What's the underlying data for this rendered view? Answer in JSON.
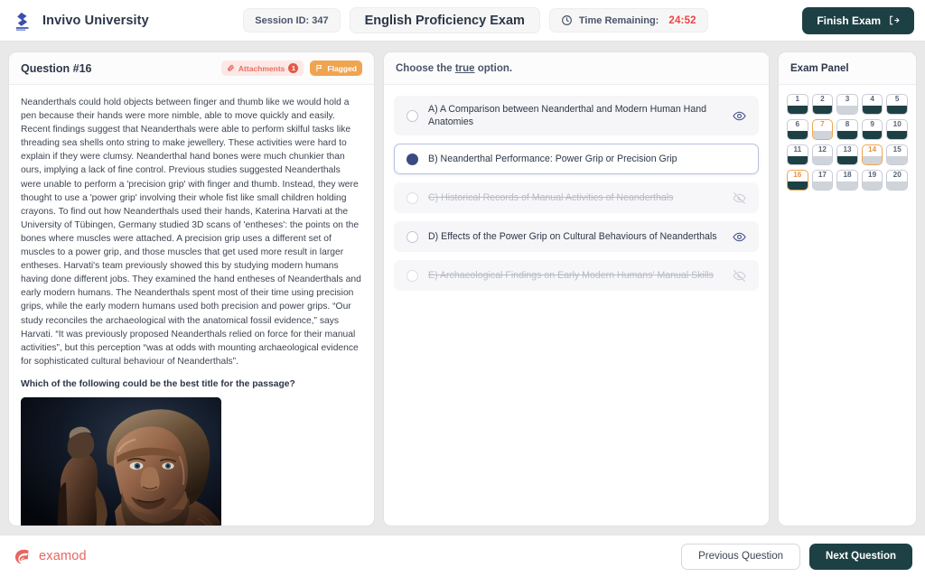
{
  "header": {
    "brand_name": "Invivo University",
    "session_pill": "Session ID: 347",
    "exam_title": "English Proficiency Exam",
    "timer_label": "Time Remaining:",
    "timer_value": "24:52",
    "finish_button": "Finish Exam"
  },
  "question_panel": {
    "title": "Question #16",
    "attachments_badge": "Attachments",
    "attachments_count": "1",
    "flagged_badge": "Flagged",
    "passage": "Neanderthals could hold objects between finger and thumb like we would hold a pen because their hands were more nimble, able to move quickly and easily. Recent findings suggest that Neanderthals were able to perform skilful tasks like threading sea shells onto string to make jewellery. These activities were hard to explain if they were clumsy. Neanderthal hand bones were much chunkier than ours, implying a lack of fine control. Previous studies suggested Neanderthals were unable to perform a 'precision grip' with finger and thumb. Instead, they were thought to use a 'power grip' involving their whole fist like small children holding crayons. To find out how Neanderthals used their hands, Katerina Harvati at the University of Tübingen, Germany studied 3D scans of 'entheses': the points on the bones where muscles were attached. A precision grip uses a different set of muscles to a power grip, and those muscles that get used more result in larger entheses. Harvati's team previously showed this by studying modern humans having done different jobs. They examined the hand entheses of Neanderthals and early modern humans. The Neanderthals spent most of their time using precision grips, while the early modern humans used both precision and power grips. “Our study reconciles the archaeological with the anatomical fossil evidence,” says Harvati. “It was previously proposed Neanderthals relied on force for their manual activities”, but this perception “was at odds with mounting archaeological evidence for sophisticated cultural behaviour of Neanderthals”.",
    "prompt": "Which of the following could be the best title for the passage?",
    "figure_alt": "Neanderthal reconstruction portrait"
  },
  "options_panel": {
    "instruction_prefix": "Choose the ",
    "instruction_emphasis": "true",
    "instruction_suffix": " option.",
    "options": [
      {
        "letter": "A",
        "text": "A) A Comparison between Neanderthal and Modern Human Hand Anatomies",
        "state": "normal",
        "eye": "eye-icon"
      },
      {
        "letter": "B",
        "text": "B) Neanderthal Performance: Power Grip or Precision Grip",
        "state": "selected",
        "eye": "none"
      },
      {
        "letter": "C",
        "text": "C) Historical Records of Manual Activities of Neanderthals",
        "state": "eliminated",
        "eye": "eye-off-icon"
      },
      {
        "letter": "D",
        "text": "D) Effects of the Power Grip on Cultural Behaviours of Neanderthals",
        "state": "normal",
        "eye": "eye-icon"
      },
      {
        "letter": "E",
        "text": "E) Archaeological Findings on Early Modern Humans' Manual Skills",
        "state": "eliminated",
        "eye": "eye-off-icon"
      }
    ]
  },
  "exam_panel": {
    "title": "Exam Panel",
    "questions": [
      {
        "number": "1",
        "answered": true,
        "flagged": false,
        "current": false
      },
      {
        "number": "2",
        "answered": true,
        "flagged": false,
        "current": false
      },
      {
        "number": "3",
        "answered": false,
        "flagged": false,
        "current": false
      },
      {
        "number": "4",
        "answered": true,
        "flagged": false,
        "current": false
      },
      {
        "number": "5",
        "answered": true,
        "flagged": false,
        "current": false
      },
      {
        "number": "6",
        "answered": true,
        "flagged": false,
        "current": false
      },
      {
        "number": "7",
        "answered": false,
        "flagged": true,
        "current": false
      },
      {
        "number": "8",
        "answered": true,
        "flagged": false,
        "current": false
      },
      {
        "number": "9",
        "answered": true,
        "flagged": false,
        "current": false
      },
      {
        "number": "10",
        "answered": true,
        "flagged": false,
        "current": false
      },
      {
        "number": "11",
        "answered": true,
        "flagged": false,
        "current": false
      },
      {
        "number": "12",
        "answered": false,
        "flagged": false,
        "current": false
      },
      {
        "number": "13",
        "answered": true,
        "flagged": false,
        "current": false
      },
      {
        "number": "14",
        "answered": false,
        "flagged": true,
        "current": false
      },
      {
        "number": "15",
        "answered": false,
        "flagged": false,
        "current": false
      },
      {
        "number": "16",
        "answered": true,
        "flagged": true,
        "current": true
      },
      {
        "number": "17",
        "answered": false,
        "flagged": false,
        "current": false
      },
      {
        "number": "18",
        "answered": false,
        "flagged": false,
        "current": false
      },
      {
        "number": "19",
        "answered": false,
        "flagged": false,
        "current": false
      },
      {
        "number": "20",
        "answered": false,
        "flagged": false,
        "current": false
      }
    ]
  },
  "footer": {
    "brand_name": "examod",
    "previous_button": "Previous Question",
    "next_button": "Next Question"
  },
  "colors": {
    "accent_dark": "#1d4044",
    "timer_red": "#ef4444",
    "flag_orange": "#f0a450",
    "attach_red": "#e05a4a",
    "brand_blue": "#3b4a80",
    "examod_red": "#e8655f"
  }
}
